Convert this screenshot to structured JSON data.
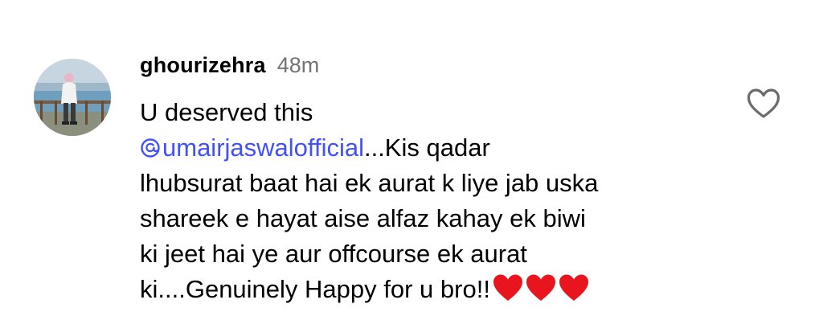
{
  "comment": {
    "username": "ghourizehra",
    "timestamp": "48m",
    "lines": [
      "U deserved this",
      "...Kis qadar",
      "lhubsurat baat hai ek aurat k liye jab uska",
      "shareek e hayat aise alfaz kahay ek biwi",
      "ki jeet hai ye aur offcourse ek aurat",
      "ki....Genuinely Happy for u bro!!"
    ],
    "mention": "umairjaswalofficial",
    "mention_icon": "threads-at-icon",
    "emojis": [
      "red-heart",
      "red-heart",
      "red-heart"
    ],
    "like_icon": "heart-outline-icon"
  },
  "colors": {
    "username": "#000000",
    "timestamp": "#737373",
    "mention": "#4150f7",
    "heart": "#e8141e",
    "like_outline": "#6b6b6b"
  }
}
